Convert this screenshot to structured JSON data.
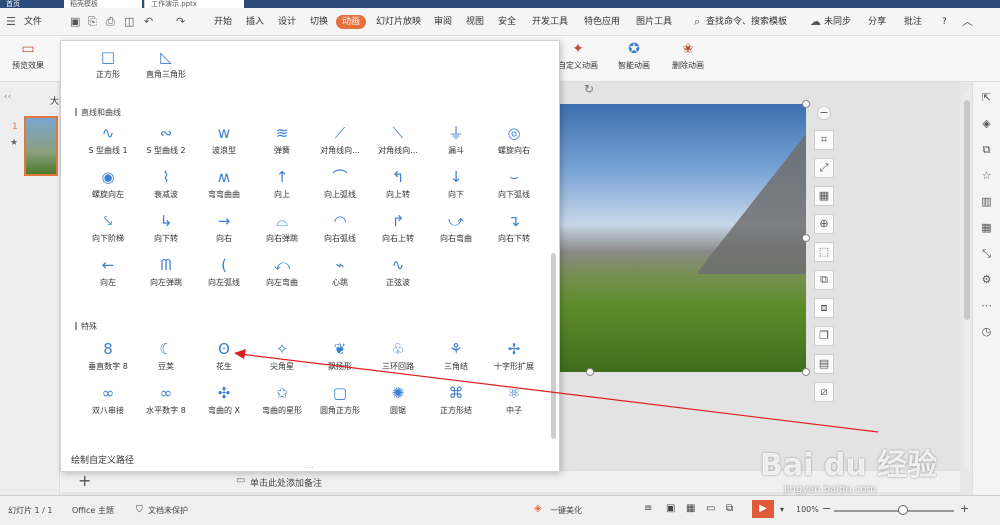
{
  "tabstrip": {
    "home": "首页",
    "tab1": "稻壳模板",
    "tab2": "工作演示.pptx",
    "user": "●"
  },
  "menubar": {
    "file": "文件",
    "items": [
      "开始",
      "插入",
      "设计",
      "切换",
      "动画",
      "幻灯片放映",
      "审阅",
      "视图",
      "安全",
      "开发工具",
      "特色应用",
      "图片工具"
    ],
    "active": "动画",
    "search": "查找命令、搜索模板",
    "sync": "未同步",
    "share": "分享",
    "comment": "批注",
    "help": "?"
  },
  "ribbon": {
    "preview": "预览效果",
    "custom_anim": "自定义动画",
    "smart_anim": "智能动画",
    "delete_anim": "删除动画"
  },
  "left": {
    "slide_num": "1",
    "star": "★",
    "collapse": "‹‹",
    "outline": "大"
  },
  "panel": {
    "top_items": [
      "正方形",
      "直角三角形"
    ],
    "section_lines": "直线和曲线",
    "lines": [
      "S 型曲线 1",
      "S 型曲线 2",
      "波浪型",
      "弹簧",
      "对角线向...",
      "对角线向...",
      "漏斗",
      "螺旋向右",
      "螺旋向左",
      "衰减波",
      "弯弯曲曲",
      "向上",
      "向上弧线",
      "向上转",
      "向下",
      "向下弧线",
      "向下阶梯",
      "向下转",
      "向右",
      "向右弹跳",
      "向右弧线",
      "向右上转",
      "向右弯曲",
      "向右下转",
      "向左",
      "向左弹跳",
      "向左弧线",
      "向左弯曲",
      "心跳",
      "正弦波"
    ],
    "section_special": "特殊",
    "special": [
      "垂直数字 8",
      "豆荚",
      "花生",
      "尖角星",
      "飘扬形",
      "三环回路",
      "三角结",
      "十字形扩展",
      "双八串接",
      "水平数字 8",
      "弯曲的 X",
      "弯曲的星形",
      "圆角正方形",
      "圆锯",
      "正方形结",
      "中子"
    ],
    "custom_path": "绘制自定义路径"
  },
  "notes": {
    "placeholder": "单击此处添加备注",
    "add": "+"
  },
  "status": {
    "slide_info": "幻灯片 1 / 1",
    "theme": "Office 主题",
    "protect": "文档未保护",
    "beautify": "一键美化",
    "zoom": "100%",
    "minus": "−",
    "plus": "+"
  },
  "watermark": {
    "logo": "Bai du 经验",
    "url": "jingyan.baidu.com"
  },
  "colors": {
    "accent": "#e86f3a",
    "arrow": "#e02020",
    "icon": "#3c7fd0"
  }
}
